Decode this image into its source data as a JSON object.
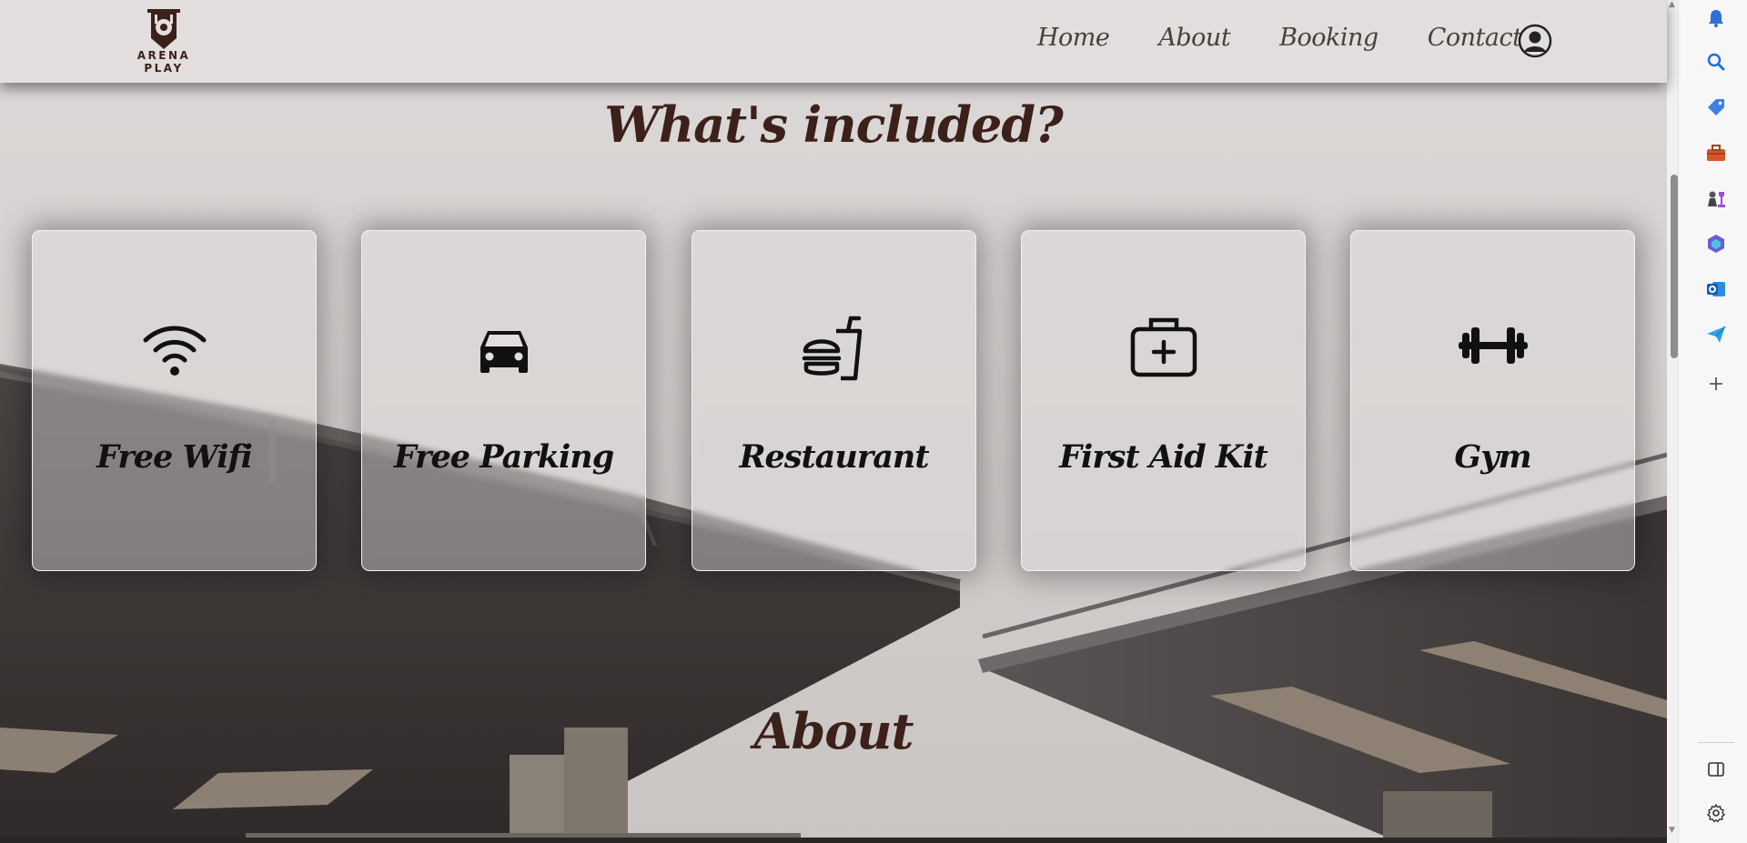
{
  "header": {
    "logo_text": "ARENA PLAY",
    "nav": [
      "Home",
      "About",
      "Booking",
      "Contact"
    ]
  },
  "sections": {
    "included_title": "What's included?",
    "about_title": "About"
  },
  "cards": [
    {
      "label": "Free Wifi",
      "icon": "wifi-icon"
    },
    {
      "label": "Free Parking",
      "icon": "car-icon"
    },
    {
      "label": "Restaurant",
      "icon": "burger-drink-icon"
    },
    {
      "label": "First Aid Kit",
      "icon": "first-aid-kit-icon"
    },
    {
      "label": "Gym",
      "icon": "dumbbell-icon"
    }
  ],
  "colors": {
    "heading": "#3c211a",
    "header_bg": "#e2dedd",
    "card_text": "#111111"
  },
  "browser_sidebar_icons": [
    "bell-icon",
    "search-icon",
    "tag-icon",
    "toolbox-icon",
    "chess-icon",
    "copilot-icon",
    "outlook-icon",
    "send-icon",
    "plus-icon",
    "split-view-icon",
    "settings-icon"
  ]
}
